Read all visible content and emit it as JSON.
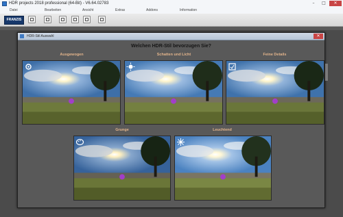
{
  "window": {
    "title": "HDR projects 2018 professional (64-Bit) - V6.64.02783"
  },
  "menu": [
    "Datei",
    "Bearbeiten",
    "Ansicht",
    "Extras",
    "Addons",
    "Information"
  ],
  "toolbar": {
    "logo": "FRANZIS"
  },
  "dialog": {
    "title": "HDR-Stil Auswahl",
    "question": "Welchen HDR-Stil bevorzugen Sie?",
    "styles": [
      {
        "label": "Ausgewogen",
        "icon": "gear-icon"
      },
      {
        "label": "Schatten und Licht",
        "icon": "sun-shadow-icon"
      },
      {
        "label": "Feine Details",
        "icon": "details-icon"
      },
      {
        "label": "Grunge",
        "icon": "palette-icon"
      },
      {
        "label": "Leuchtend",
        "icon": "star-icon"
      }
    ]
  },
  "colors": {
    "accent_label": "#e2b48b",
    "dialog_bg": "#595959",
    "app_bg": "#4b4b4b"
  }
}
